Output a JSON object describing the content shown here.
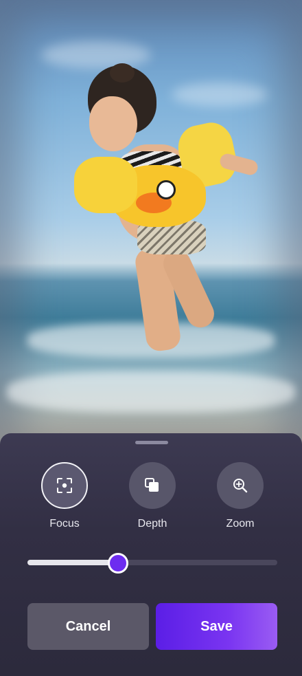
{
  "tools": [
    {
      "label": "Focus",
      "icon": "focus-icon",
      "active": true
    },
    {
      "label": "Depth",
      "icon": "layers-icon",
      "active": false
    },
    {
      "label": "Zoom",
      "icon": "zoom-in-icon",
      "active": false
    }
  ],
  "slider": {
    "value": 0.36
  },
  "actions": {
    "cancel_label": "Cancel",
    "save_label": "Save"
  },
  "colors": {
    "accent": "#6d2cf0",
    "sheet": "#322f44"
  }
}
